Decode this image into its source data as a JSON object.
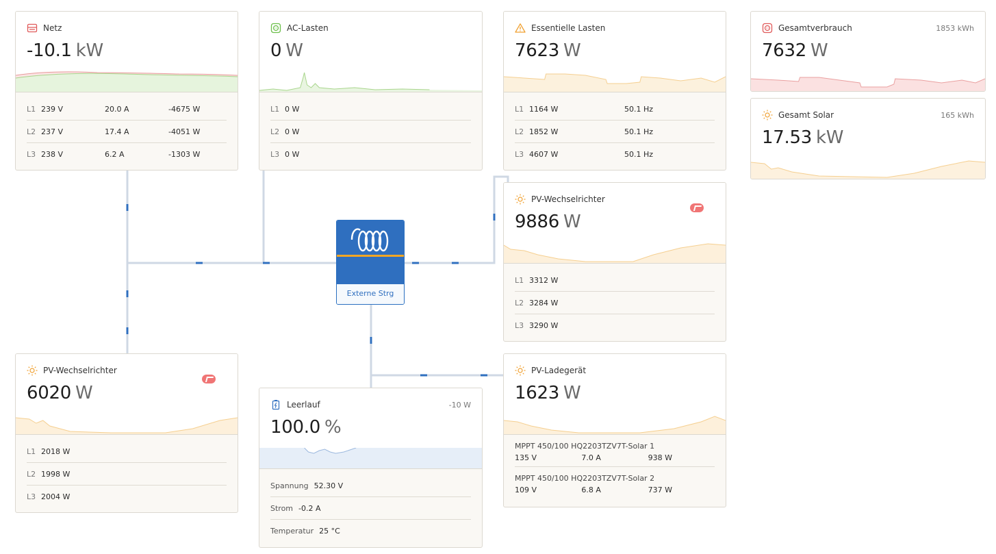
{
  "netz": {
    "title": "Netz",
    "value": "-10.1",
    "unit": "kW",
    "rows": [
      {
        "l": "L1",
        "v": "239 V",
        "a": "20.0 A",
        "w": "-4675 W"
      },
      {
        "l": "L2",
        "v": "237 V",
        "a": "17.4 A",
        "w": "-4051 W"
      },
      {
        "l": "L3",
        "v": "238 V",
        "a": "6.2 A",
        "w": "-1303 W"
      }
    ]
  },
  "ac_lasten": {
    "title": "AC-Lasten",
    "value": "0",
    "unit": "W",
    "rows": [
      {
        "l": "L1",
        "w": "0 W"
      },
      {
        "l": "L2",
        "w": "0 W"
      },
      {
        "l": "L3",
        "w": "0 W"
      }
    ]
  },
  "essentielle": {
    "title": "Essentielle Lasten",
    "value": "7623",
    "unit": "W",
    "rows": [
      {
        "l": "L1",
        "w": "1164 W",
        "hz": "50.1 Hz"
      },
      {
        "l": "L2",
        "w": "1852 W",
        "hz": "50.1 Hz"
      },
      {
        "l": "L3",
        "w": "4607 W",
        "hz": "50.1 Hz"
      }
    ]
  },
  "gesamtverbrauch": {
    "title": "Gesamtverbrauch",
    "value": "7632",
    "unit": "W",
    "aux": "1853 kWh"
  },
  "gesamt_solar": {
    "title": "Gesamt Solar",
    "value": "17.53",
    "unit": "kW",
    "aux": "165 kWh"
  },
  "pv_wr_right": {
    "title": "PV-Wechselrichter",
    "value": "9886",
    "unit": "W",
    "rows": [
      {
        "l": "L1",
        "w": "3312 W"
      },
      {
        "l": "L2",
        "w": "3284 W"
      },
      {
        "l": "L3",
        "w": "3290 W"
      }
    ]
  },
  "pv_wr_left": {
    "title": "PV-Wechselrichter",
    "value": "6020",
    "unit": "W",
    "rows": [
      {
        "l": "L1",
        "w": "2018 W"
      },
      {
        "l": "L2",
        "w": "1998 W"
      },
      {
        "l": "L3",
        "w": "2004 W"
      }
    ]
  },
  "leerlauf": {
    "title": "Leerlauf",
    "value": "100.0",
    "unit": "%",
    "aux": "-10 W",
    "rows": [
      {
        "k": "Spannung",
        "v": "52.30 V"
      },
      {
        "k": "Strom",
        "v": "-0.2 A"
      },
      {
        "k": "Temperatur",
        "v": "25 °C"
      }
    ]
  },
  "pv_lader": {
    "title": "PV-Ladegerät",
    "value": "1623",
    "unit": "W",
    "mppts": [
      {
        "name": "MPPT 450/100 HQ2203TZV7T-Solar 1",
        "v": "135 V",
        "a": "7.0 A",
        "w": "938 W"
      },
      {
        "name": "MPPT 450/100 HQ2203TZV7T-Solar 2",
        "v": "109 V",
        "a": "6.8 A",
        "w": "737 W"
      }
    ]
  },
  "inverter": {
    "label": "Externe Strg"
  },
  "colors": {
    "grid": "#e05a5a",
    "acload": "#6cbf4a",
    "solar": "#f0a030",
    "consumption": "#e05a5a",
    "battery": "#2f6fbf",
    "wire": "#c9d4e2",
    "flow": "#2f6fbf"
  }
}
